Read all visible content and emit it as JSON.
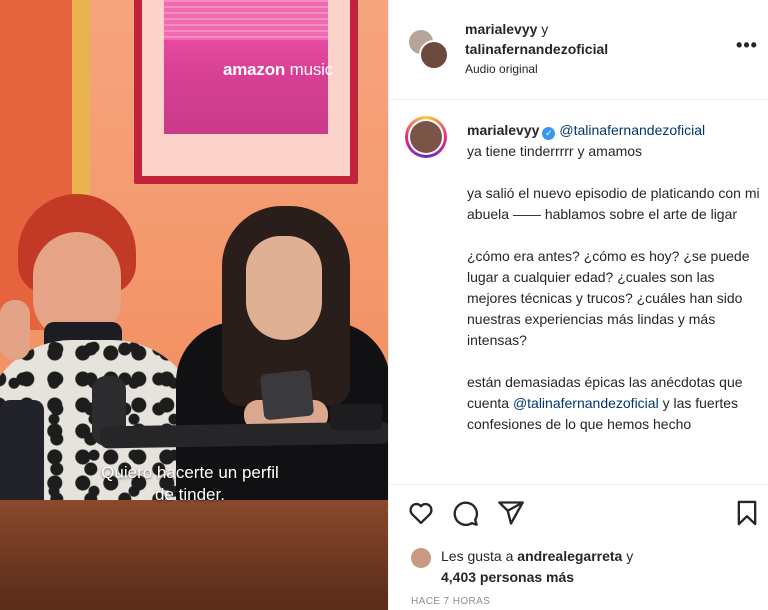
{
  "media": {
    "brand_main": "amazon",
    "brand_sub": "music",
    "caption_line1": "Quiero hacerte un perfil",
    "caption_line2": "de tinder."
  },
  "header": {
    "user1": "marialevyy",
    "conjunction": "y",
    "user2": "talinafernandezoficial",
    "audio_label": "Audio original",
    "more_icon": "more-horizontal-icon"
  },
  "comment": {
    "author": "marialevyy",
    "verified_icon": "verified-badge-icon",
    "mention": "@talinafernandezoficial",
    "line1": "ya tiene tinderrrrr y amamos",
    "para2": "ya salió el nuevo episodio de platicando con mi abuela —— hablamos sobre el arte de ligar",
    "para3": "¿cómo era antes? ¿cómo es hoy? ¿se puede lugar a cualquier edad? ¿cuales son las mejores técnicas y trucos? ¿cuáles han sido nuestras experiencias más lindas y más intensas?",
    "para4_start": "están demasiadas épicas las anécdotas que cuenta",
    "para4_mention": "@talinafernandezoficial",
    "para4_end": "y las fuertes confesiones de lo que hemos hecho"
  },
  "actions": {
    "like_icon": "heart-icon",
    "comment_icon": "comment-icon",
    "share_icon": "share-icon",
    "save_icon": "bookmark-icon"
  },
  "likes": {
    "prefix": "Les gusta a",
    "user": "andrealegarreta",
    "middle": "y",
    "count": "4,403 personas más"
  },
  "timestamp": "HACE 7 HORAS",
  "colors": {
    "text": "#262626",
    "muted": "#8e8e8e",
    "mention": "#00376b",
    "verified": "#3897f0",
    "divider": "#efefef"
  }
}
